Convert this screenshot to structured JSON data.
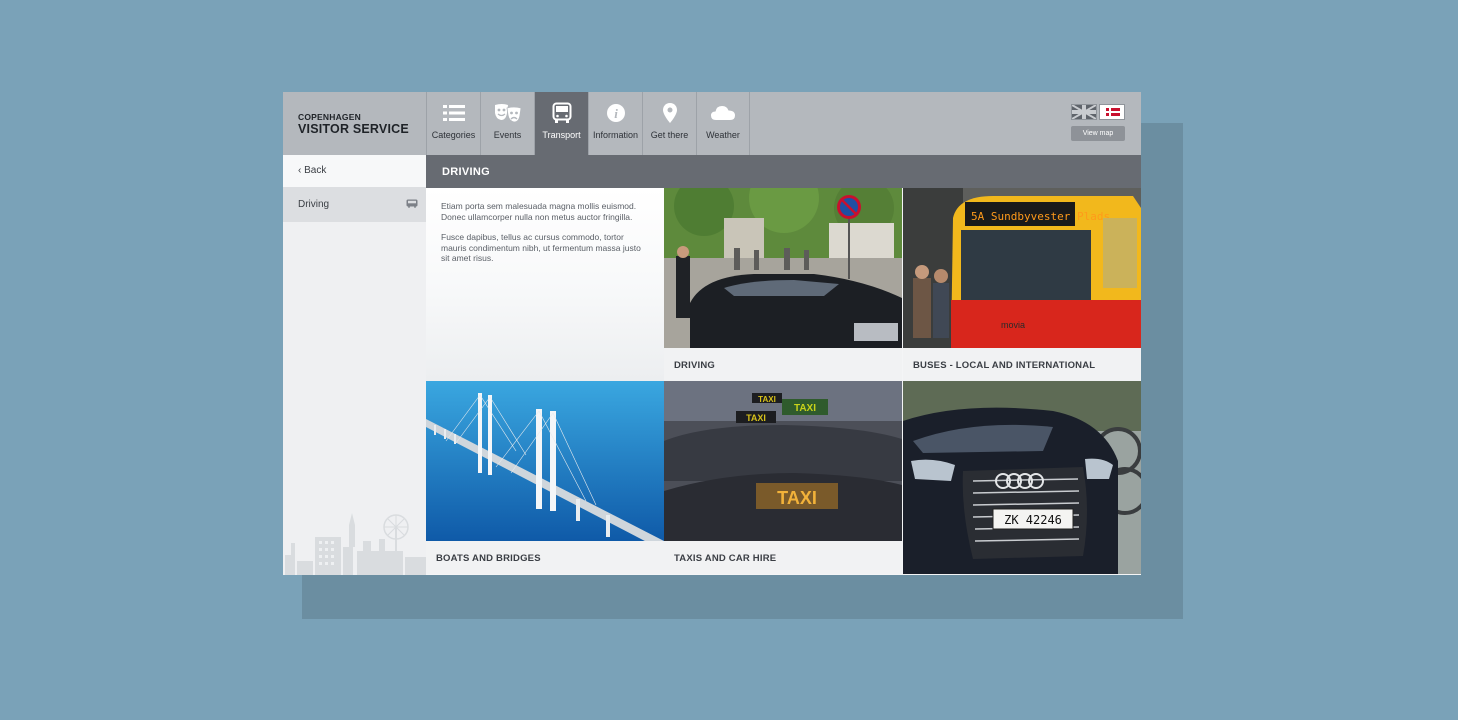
{
  "logo": {
    "line1": "COPENHAGEN",
    "line2": "VISITOR SERVICE"
  },
  "nav": [
    {
      "label": "Categories",
      "icon": "list-icon"
    },
    {
      "label": "Events",
      "icon": "theater-masks-icon"
    },
    {
      "label": "Transport",
      "icon": "bus-front-icon",
      "active": true
    },
    {
      "label": "Information",
      "icon": "info-icon"
    },
    {
      "label": "Get there",
      "icon": "location-pin-icon"
    },
    {
      "label": "Weather",
      "icon": "cloud-icon"
    }
  ],
  "language": {
    "options": [
      "English",
      "Danish"
    ]
  },
  "view_map_label": "View map",
  "sidebar": {
    "back_label": "Back",
    "items": [
      {
        "label": "Driving",
        "icon": "bus-icon"
      }
    ]
  },
  "main": {
    "title": "DRIVING",
    "intro": [
      "Etiam porta sem malesuada magna mollis euismod. Donec ullamcorper nulla non metus auctor fringilla.",
      "Fusce dapibus, tellus ac cursus commodo, tortor mauris condimentum nibh, ut fermentum massa justo sit amet risus."
    ],
    "tiles": [
      {
        "caption": "DRIVING"
      },
      {
        "caption": "BUSES - LOCAL AND INTERNATIONAL"
      },
      {
        "caption": "BOATS AND BRIDGES"
      },
      {
        "caption": "TAXIS AND CAR HIRE"
      },
      {
        "caption": ""
      }
    ],
    "photo_text": {
      "bus_sign": "5A Sundbyvester Plads",
      "bus_brand": "movia",
      "taxi_sign": "TAXI",
      "plate": "ZK 42246"
    }
  },
  "colors": {
    "background": "#7aa2b8",
    "topbar": "#b4b8bd",
    "active_tab": "#676b72",
    "title_bar": "#676b72",
    "danish_red": "#c8102e"
  }
}
